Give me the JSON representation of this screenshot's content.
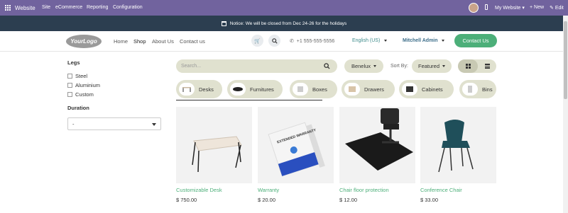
{
  "topbar": {
    "app_name": "Website",
    "menu": [
      "Site",
      "eCommerce",
      "Reporting",
      "Configuration"
    ],
    "website_switch": "My Website",
    "new_label": "New",
    "edit_label": "Edit"
  },
  "notice": "Notice: We will be closed from Dec 24-26 for the holidays",
  "header": {
    "logo_text": "YourLogo",
    "nav": [
      "Home",
      "Shop",
      "About Us",
      "Contact us"
    ],
    "phone": "+1 555-555-5556",
    "language": "English (US)",
    "user": "Mitchell Admin",
    "contact_button": "Contact Us"
  },
  "sidebar": {
    "legs_title": "Legs",
    "legs_options": [
      "Steel",
      "Aluminium",
      "Custom"
    ],
    "duration_title": "Duration",
    "duration_value": "-"
  },
  "toolbar": {
    "search_placeholder": "Search...",
    "pricelist": "Benelux",
    "sort_label": "Sort By:",
    "sort_value": "Featured"
  },
  "categories": [
    "Desks",
    "Furnitures",
    "Boxes",
    "Drawers",
    "Cabinets",
    "Bins"
  ],
  "products": [
    {
      "name": "Customizable Desk",
      "price": "$ 750.00"
    },
    {
      "name": "Warranty",
      "price": "$ 20.00"
    },
    {
      "name": "Chair floor protection",
      "price": "$ 12.00"
    },
    {
      "name": "Conference Chair",
      "price": "$ 33.00"
    }
  ],
  "warranty_box_text": "EXTENDED WARRANTY",
  "colors": {
    "topbar": "#71639e",
    "notice": "#2c3e50",
    "accent_green": "#4caf79",
    "pill_bg": "#e0e1cf"
  }
}
